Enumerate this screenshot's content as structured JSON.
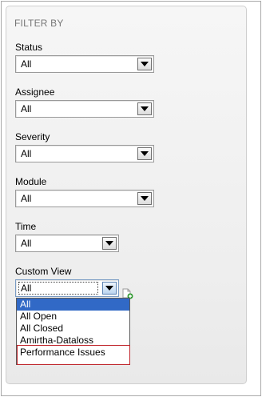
{
  "filter_panel": {
    "title": "FILTER BY",
    "fields": [
      {
        "label": "Status",
        "value": "All"
      },
      {
        "label": "Assignee",
        "value": "All"
      },
      {
        "label": "Severity",
        "value": "All"
      },
      {
        "label": "Module",
        "value": "All"
      },
      {
        "label": "Time",
        "value": "All"
      },
      {
        "label": "Custom View",
        "value": "All"
      }
    ],
    "custom_view_options": [
      "All",
      "All Open",
      "All Closed",
      "Amirtha-Dataloss",
      "Performance Issues"
    ],
    "custom_view_selected_option": "All",
    "highlighted_option": "Performance Issues"
  },
  "icons": {
    "dropdown_arrow": "triangle-down-icon",
    "add_view": "add-document-icon"
  },
  "colors": {
    "selected_option_bg": "#3169c6",
    "highlight_border": "#c0272d",
    "title_text": "#777777"
  }
}
